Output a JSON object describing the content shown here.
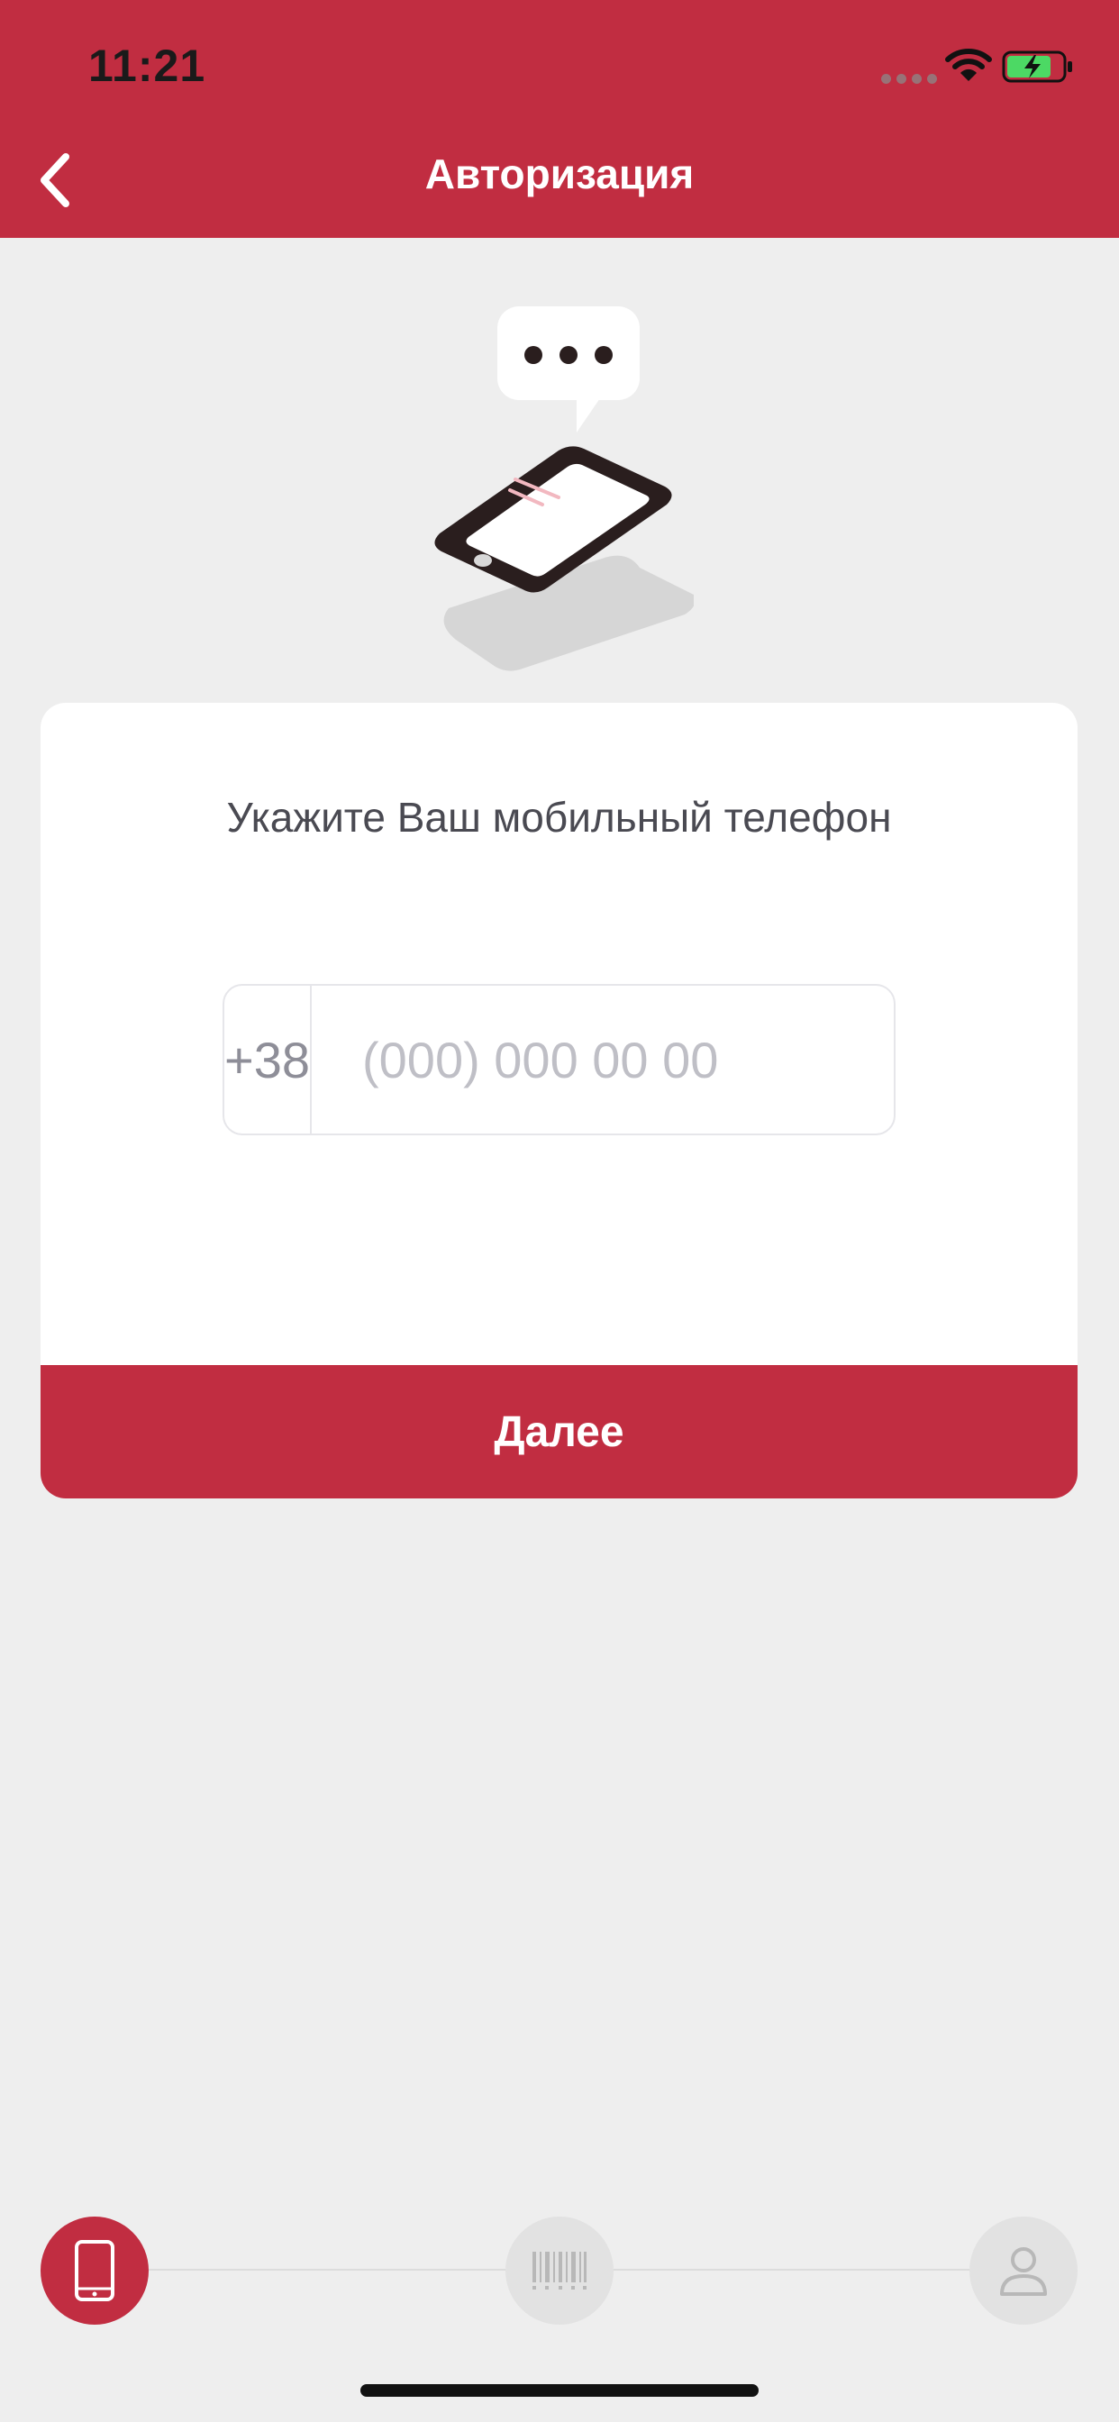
{
  "status_bar": {
    "time": "11:21"
  },
  "header": {
    "title": "Авторизация"
  },
  "card": {
    "prompt": "Укажите Ваш мобильный телефон",
    "phone": {
      "country_code": "+38",
      "placeholder": "(000) 000 00 00",
      "value": ""
    },
    "next_label": "Далее"
  },
  "steps": [
    {
      "icon": "mobile-phone-icon",
      "state": "active"
    },
    {
      "icon": "barcode-icon",
      "state": "inactive"
    },
    {
      "icon": "user-icon",
      "state": "inactive"
    }
  ],
  "colors": {
    "brand": "#c12d41",
    "background": "#eeeeee",
    "card": "#ffffff",
    "inactive_step": "#e2e2e2"
  }
}
